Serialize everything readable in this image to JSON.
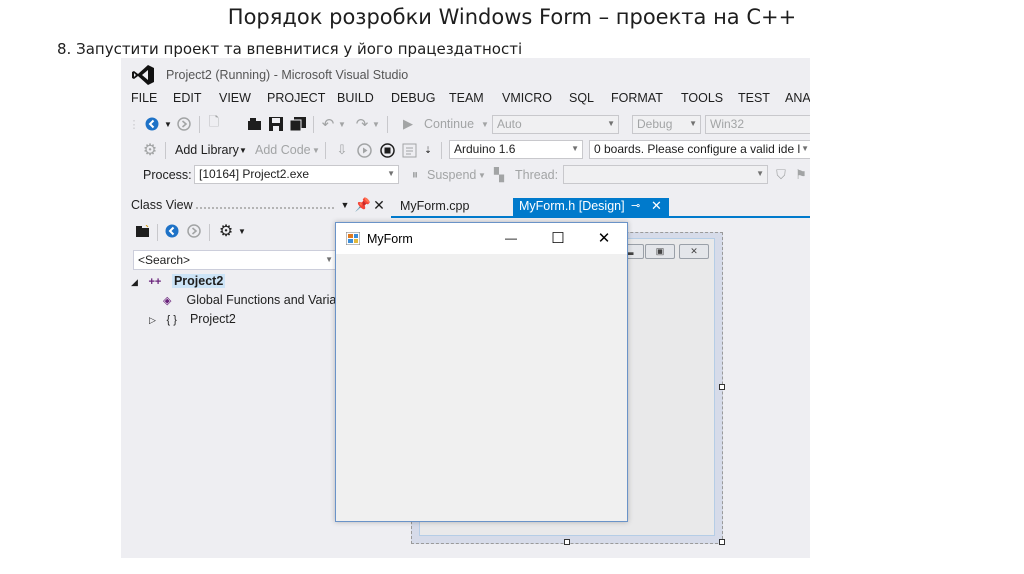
{
  "slide": {
    "title": "Порядок розробки  Windows Form – проекта на С++",
    "subtitle": "8. Запустити проект та впевнитися у його працездатності"
  },
  "vs": {
    "window_title": "Project2 (Running) - Microsoft Visual Studio",
    "menu": [
      "FILE",
      "EDIT",
      "VIEW",
      "PROJECT",
      "BUILD",
      "DEBUG",
      "TEAM",
      "VMICRO",
      "SQL",
      "FORMAT",
      "TOOLS",
      "TEST",
      "ANA"
    ],
    "toolbar1": {
      "continue_label": "Continue",
      "config_auto": "Auto",
      "config_debug": "Debug",
      "platform": "Win32"
    },
    "toolbar2": {
      "add_library": "Add Library",
      "add_code": "Add Code",
      "board": "Arduino 1.6",
      "board_status": "0 boards. Please configure a valid ide l"
    },
    "toolbar3": {
      "process_label": "Process:",
      "process_value": "[10164] Project2.exe",
      "suspend_label": "Suspend",
      "thread_label": "Thread:"
    },
    "class_view": {
      "header": "Class View",
      "search_placeholder": "<Search>",
      "tree": [
        {
          "label": "Project2",
          "expander": "◢",
          "icon": "++"
        },
        {
          "label": "Global Functions and Variab",
          "expander": "",
          "icon": "◈"
        },
        {
          "label": "Project2",
          "expander": "▷",
          "icon": "{ }"
        }
      ]
    },
    "tabs": [
      {
        "label": "MyForm.cpp",
        "active": false
      },
      {
        "label": "MyForm.h [Design]",
        "active": true
      }
    ],
    "tab_pin_icon": "pin-icon",
    "accent": "#007acc"
  },
  "running_form": {
    "title": "MyForm",
    "minimize_glyph": "—",
    "maximize_glyph": "☐",
    "close_glyph": "✕"
  }
}
